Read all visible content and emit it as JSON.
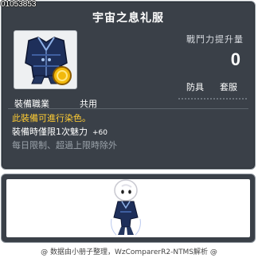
{
  "item_id": "01053853",
  "title": "宇宙之息礼服",
  "attack": {
    "label": "戰鬥力提升量",
    "value": "0"
  },
  "tags": [
    "防具",
    "套服"
  ],
  "job": {
    "label": "裝備職業",
    "value": "共用"
  },
  "description": {
    "line1": "此裝備可進行染色。",
    "line2": "裝備時僅限1次魅力",
    "line2_bonus": "+60",
    "line3": "每日限制、超過上限時除外"
  },
  "footer": "@ 数据由小册子整理，WzComparerR2-NTMS解析 @",
  "colors": {
    "panel": "#3a4048",
    "border": "#8c949c",
    "highlight": "#ffcc33",
    "muted": "#9aa2aa",
    "outfit": "#1e2f5a"
  },
  "icons": [
    "outfit-icon",
    "coin-icon",
    "character-avatar"
  ]
}
